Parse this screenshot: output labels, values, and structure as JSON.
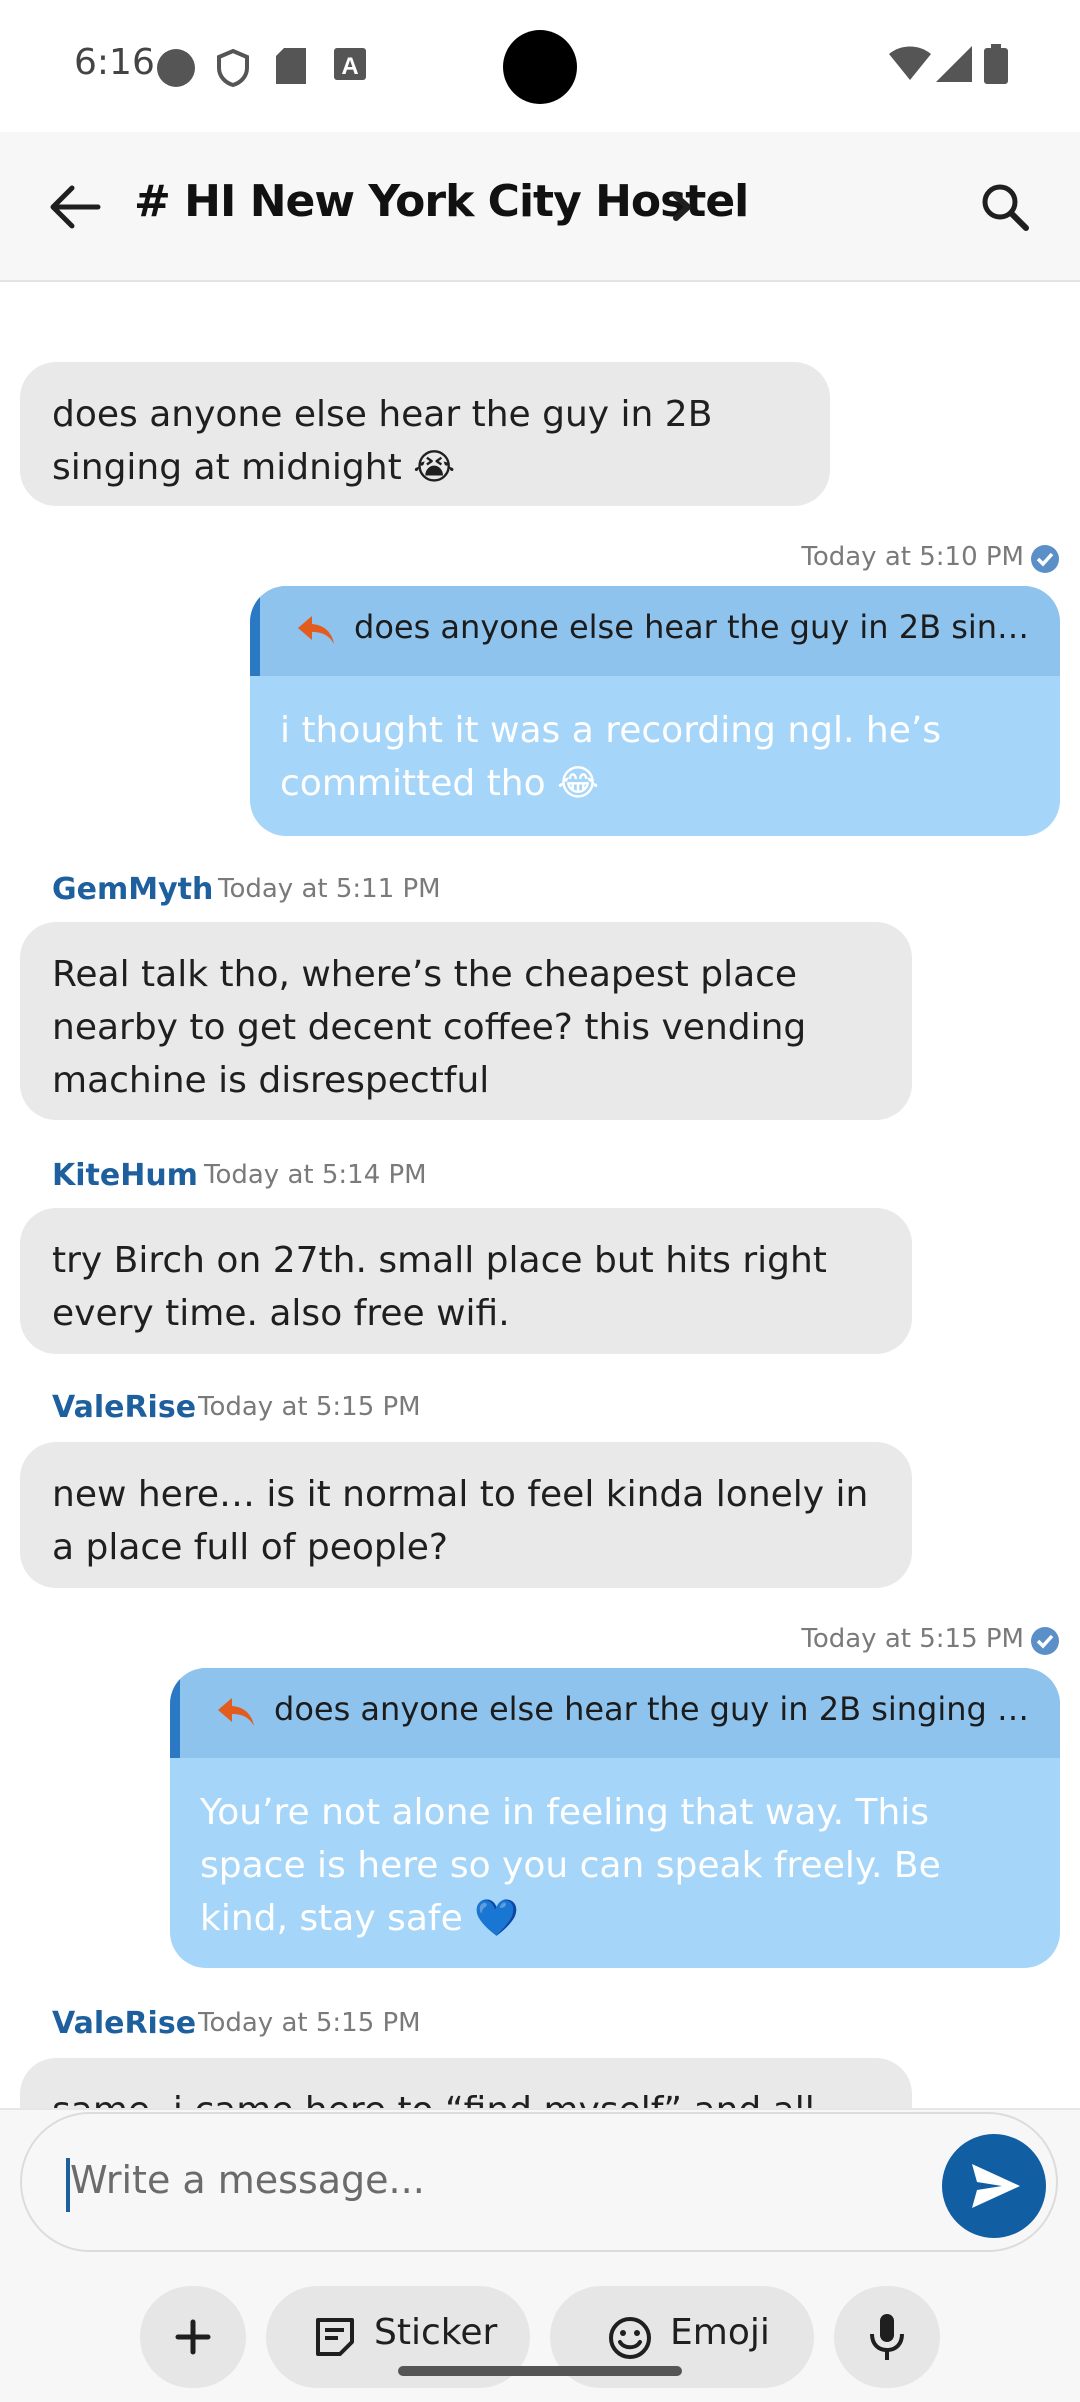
{
  "status_bar": {
    "time": "6:16",
    "icons": [
      "circle-icon",
      "shield-icon",
      "sd-card-icon",
      "a-icon",
      "wifi-icon",
      "cell-signal-icon",
      "battery-icon"
    ]
  },
  "header": {
    "back_icon": "arrow-left-icon",
    "title": "# HI New York City Hostel",
    "chevron_icon": "chevron-right-icon",
    "search_icon": "search-icon"
  },
  "messages": [
    {
      "type": "incoming",
      "text": "does anyone else hear the guy in 2B singing at midnight 😭"
    },
    {
      "type": "outgoing",
      "time": "Today at 5:10 PM",
      "reply_to": "does anyone else hear the guy in 2B singin...",
      "text": "i thought it was a recording ngl. he’s committed tho 😂"
    },
    {
      "type": "incoming",
      "sender": "GemMyth",
      "time": "Today at 5:11 PM",
      "text": "Real talk tho, where’s the cheapest place nearby to get decent coffee? this vending machine is disrespectful"
    },
    {
      "type": "incoming",
      "sender": "KiteHum",
      "time": "Today at 5:14 PM",
      "text": "try Birch on 27th. small place but hits right every time. also free wifi."
    },
    {
      "type": "incoming",
      "sender": "ValeRise",
      "time": "Today at 5:15 PM",
      "text": "new here… is it normal to feel kinda lonely in a place full of people?"
    },
    {
      "type": "outgoing",
      "time": "Today at 5:15 PM",
      "reply_to": "does anyone else hear the guy in 2B singing at ...",
      "text": "You’re not alone in feeling that way. This space is here so you can speak freely. Be kind, stay safe 💙"
    },
    {
      "type": "incoming",
      "sender": "ValeRise",
      "time": "Today at 5:15 PM",
      "text": "same. i came here to “find myself” and all i’ve"
    }
  ],
  "composer": {
    "placeholder": "Write a message...",
    "sticker_label": "Sticker",
    "emoji_label": "Emoji"
  },
  "colors": {
    "accent": "#115ea3",
    "incoming_bubble": "#e9e9e9",
    "outgoing_bubble": "#a5d5f9",
    "sender_name": "#1e5f9e"
  }
}
